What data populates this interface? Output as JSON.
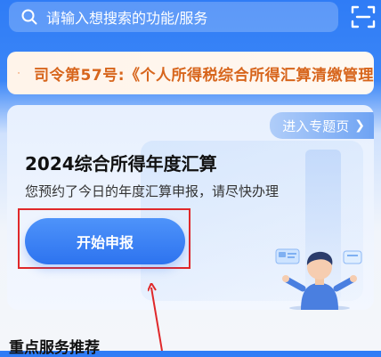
{
  "search": {
    "placeholder": "请输入想搜索的功能/服务",
    "icon": "search-icon"
  },
  "header": {
    "scan_icon": "scan-icon"
  },
  "notice": {
    "text": "司令第57号:《个人所得税综合所得汇算清缴管理",
    "icon": "bell-icon",
    "color": "#d7651c"
  },
  "card": {
    "topic_link": "进入专题页",
    "title": "2024综合所得年度汇算",
    "subtitle": "您预约了今日的年度汇算申报，请尽快办理",
    "start_button": "开始申报"
  },
  "section": {
    "title": "重点服务推荐"
  },
  "colors": {
    "brand_blue": "#2f7cf6",
    "button_blue": "#3b7ff3",
    "highlight_red": "#e0282a"
  }
}
